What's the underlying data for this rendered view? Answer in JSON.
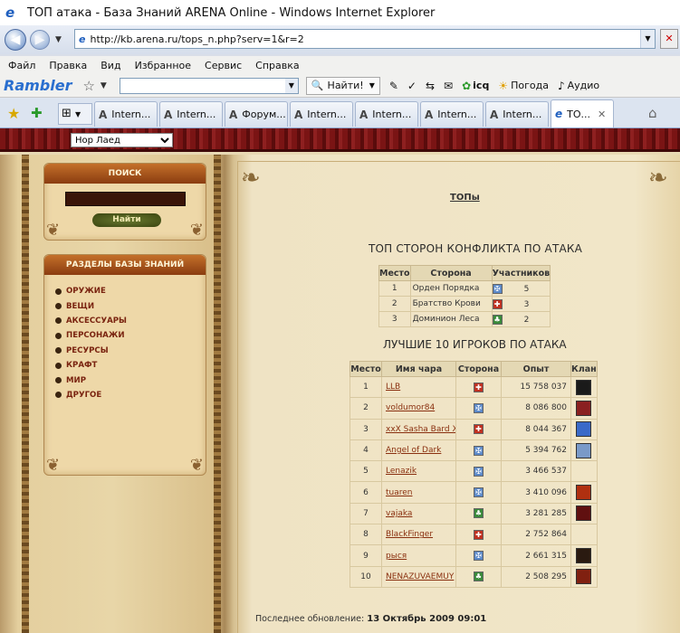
{
  "window": {
    "title": "ТОП атака - База Знаний ARENA Online - Windows Internet Explorer"
  },
  "address": {
    "url": "http://kb.arena.ru/tops_n.php?serv=1&r=2"
  },
  "menu": [
    "Файл",
    "Правка",
    "Вид",
    "Избранное",
    "Сервис",
    "Справка"
  ],
  "rambler": {
    "logo": "Rambler",
    "find": "Найти!",
    "icq": "icq",
    "weather": "Погода",
    "audio": "Аудио"
  },
  "tabs": [
    "Intern...",
    "Intern...",
    "Форум...",
    "Intern...",
    "Intern...",
    "Intern...",
    "Intern...",
    "ТО..."
  ],
  "server_select": "Нор Лаед",
  "search": {
    "title": "ПОИСК",
    "button": "Найти"
  },
  "sections": {
    "title": "РАЗДЕЛЫ БАЗЫ ЗНАНИЙ",
    "items": [
      "ОРУЖИЕ",
      "ВЕЩИ",
      "АКСЕССУАРЫ",
      "ПЕРСОНАЖИ",
      "РЕСУРСЫ",
      "КРАФТ",
      "МИР",
      "ДРУГОЕ"
    ]
  },
  "main": {
    "tops_link": "ТОПы",
    "sides_title": "ТОП СТОРОН КОНФЛИКТА ПО АТАКА",
    "sides_headers": [
      "Место",
      "Сторона",
      "Участников"
    ],
    "sides": [
      {
        "place": "1",
        "name": "Орден Порядка",
        "side": "order",
        "count": "5"
      },
      {
        "place": "2",
        "name": "Братство Крови",
        "side": "blood",
        "count": "3"
      },
      {
        "place": "3",
        "name": "Доминион Леса",
        "side": "forest",
        "count": "2"
      }
    ],
    "players_title": "ЛУЧШИЕ 10 ИГРОКОВ ПО АТАКА",
    "players_headers": [
      "Место",
      "Имя чара",
      "Сторона",
      "Опыт",
      "Клан"
    ],
    "players": [
      {
        "place": "1",
        "name": "LLB",
        "side": "blood",
        "exp": "15 758 037",
        "clan": "#1a1a1a"
      },
      {
        "place": "2",
        "name": "voldumor84",
        "side": "order",
        "exp": "8 086 800",
        "clan": "#8a2020"
      },
      {
        "place": "3",
        "name": "xxX Sasha Bard Xxx",
        "side": "blood",
        "exp": "8 044 367",
        "clan": "#3a6ac8"
      },
      {
        "place": "4",
        "name": "Angel of Dark",
        "side": "order",
        "exp": "5 394 762",
        "clan": "#7a9ac8"
      },
      {
        "place": "5",
        "name": "Lenazik",
        "side": "order",
        "exp": "3 466 537",
        "clan": ""
      },
      {
        "place": "6",
        "name": "tuaren",
        "side": "order",
        "exp": "3 410 096",
        "clan": "#b03010"
      },
      {
        "place": "7",
        "name": "vajaka",
        "side": "forest",
        "exp": "3 281 285",
        "clan": "#601010"
      },
      {
        "place": "8",
        "name": "BlackFinger",
        "side": "blood",
        "exp": "2 752 864",
        "clan": ""
      },
      {
        "place": "9",
        "name": "рыся",
        "side": "order",
        "exp": "2 661 315",
        "clan": "#2a1a10"
      },
      {
        "place": "10",
        "name": "NENAZUVAEMUY",
        "side": "forest",
        "exp": "2 508 295",
        "clan": "#802010"
      }
    ],
    "updated_label": "Последнее обновление:",
    "updated_value": "13 Октябрь 2009 09:01"
  }
}
